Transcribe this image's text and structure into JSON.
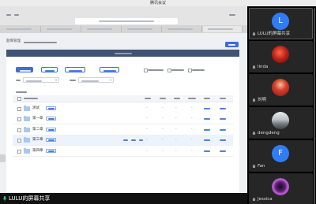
{
  "window": {
    "title": "腾讯会议"
  },
  "page": {
    "breadcrumb": "题库管理"
  },
  "table": {
    "rows": [
      {
        "name": "测试"
      },
      {
        "name": "第一章"
      },
      {
        "name": "第二章"
      },
      {
        "name": "第三章"
      },
      {
        "name": "第四章"
      }
    ],
    "empty_value": "-"
  },
  "share_status": {
    "label": "LULU的屏幕共享"
  },
  "participants": [
    {
      "name": "LULU的屏幕共享",
      "initial": "L"
    },
    {
      "name": "linda"
    },
    {
      "name": "刘明"
    },
    {
      "name": "dengdeng"
    },
    {
      "name": "Fan",
      "initial": "F"
    },
    {
      "name": "Jessica"
    }
  ],
  "colors": {
    "accent": "#3b6fd9",
    "card_header": "#3f5376",
    "avatar_blue": "#2f7cf6",
    "mic_active": "#2ecc71",
    "row_highlight": "#edf3fc"
  }
}
